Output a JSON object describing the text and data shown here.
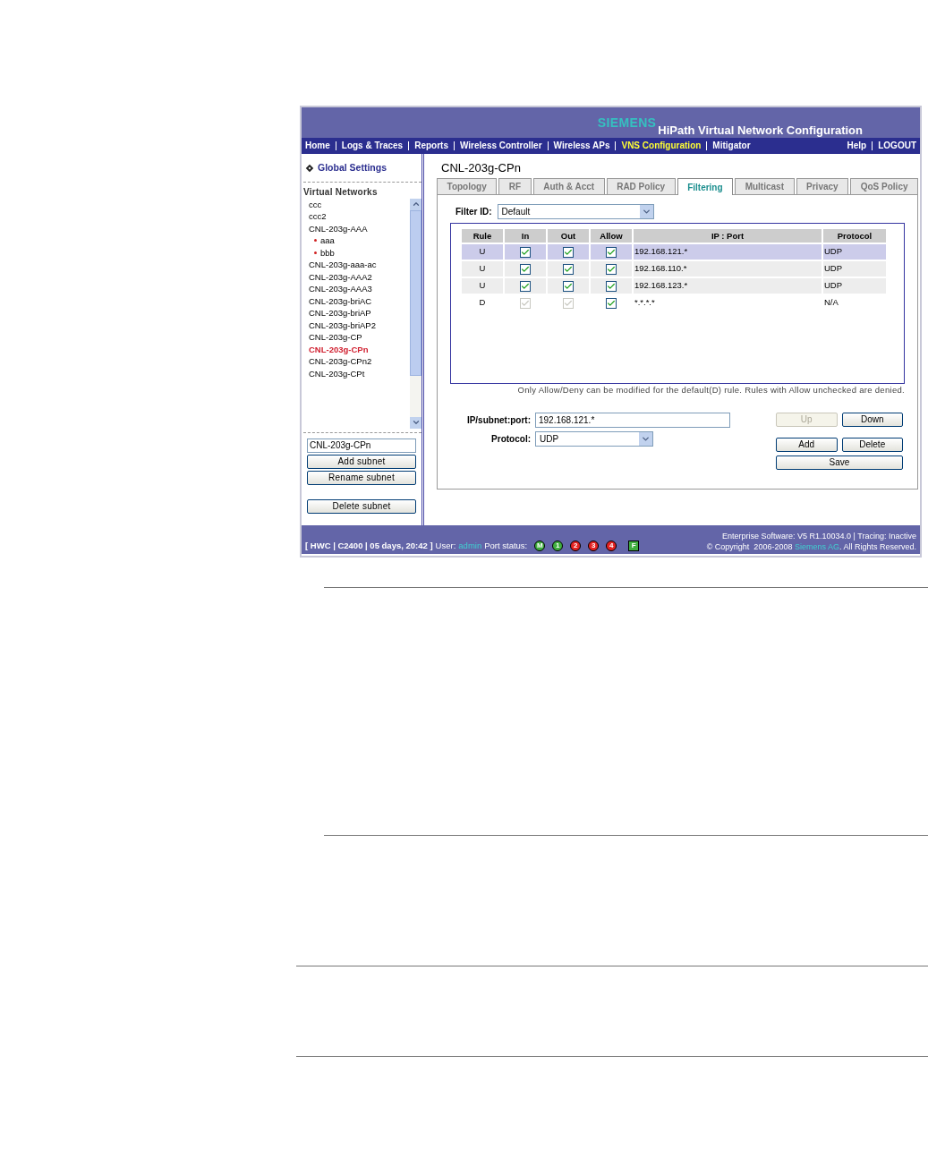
{
  "header": {
    "brand": "SIEMENS",
    "title": "HiPath Virtual Network Configuration"
  },
  "nav": {
    "items": [
      {
        "label": "Home",
        "selected": false
      },
      {
        "label": "Logs & Traces",
        "selected": false
      },
      {
        "label": "Reports",
        "selected": false
      },
      {
        "label": "Wireless Controller",
        "selected": false
      },
      {
        "label": "Wireless APs",
        "selected": false
      },
      {
        "label": "VNS Configuration",
        "selected": true
      },
      {
        "label": "Mitigator",
        "selected": false
      }
    ],
    "right_items": [
      {
        "label": "Help"
      },
      {
        "label": "LOGOUT"
      }
    ]
  },
  "sidebar": {
    "global_settings": "Global Settings",
    "section_title": "Virtual Networks",
    "items": [
      {
        "label": "ccc",
        "selected": false
      },
      {
        "label": "ccc2",
        "selected": false
      },
      {
        "label": "CNL-203g-AAA",
        "selected": false,
        "children": [
          {
            "label": "aaa",
            "selected": false
          },
          {
            "label": "bbb",
            "selected": false
          }
        ]
      },
      {
        "label": "CNL-203g-aaa-ac",
        "selected": false
      },
      {
        "label": "CNL-203g-AAA2",
        "selected": false
      },
      {
        "label": "CNL-203g-AAA3",
        "selected": false
      },
      {
        "label": "CNL-203g-briAC",
        "selected": false
      },
      {
        "label": "CNL-203g-briAP",
        "selected": false
      },
      {
        "label": "CNL-203g-briAP2",
        "selected": false
      },
      {
        "label": "CNL-203g-CP",
        "selected": false
      },
      {
        "label": "CNL-203g-CPn",
        "selected": true
      },
      {
        "label": "CNL-203g-CPn2",
        "selected": false
      },
      {
        "label": "CNL-203g-CPt",
        "selected": false
      }
    ],
    "name_field": {
      "value": "CNL-203g-CPn"
    },
    "buttons": [
      "Add subnet",
      "Rename subnet",
      "Delete subnet"
    ]
  },
  "main": {
    "title": "CNL-203g-CPn",
    "tabs": [
      {
        "label": "Topology",
        "selected": false
      },
      {
        "label": "RF",
        "selected": false
      },
      {
        "label": "Auth & Acct",
        "selected": false
      },
      {
        "label": "RAD Policy",
        "selected": false
      },
      {
        "label": "Filtering",
        "selected": true
      },
      {
        "label": "Multicast",
        "selected": false
      },
      {
        "label": "Privacy",
        "selected": false
      },
      {
        "label": "QoS Policy",
        "selected": false
      }
    ],
    "filter_id": {
      "label": "Filter ID:",
      "value": "Default"
    },
    "table": {
      "columns": [
        "Rule",
        "In",
        "Out",
        "Allow",
        "IP : Port",
        "Protocol"
      ],
      "rows": [
        {
          "rule": "U",
          "in": {
            "checked": true,
            "disabled": false
          },
          "out": {
            "checked": true,
            "disabled": false
          },
          "allow": {
            "checked": true,
            "disabled": false
          },
          "ip_port": "192.168.121.*",
          "protocol": "UDP",
          "selected": true
        },
        {
          "rule": "U",
          "in": {
            "checked": true,
            "disabled": false
          },
          "out": {
            "checked": true,
            "disabled": false
          },
          "allow": {
            "checked": true,
            "disabled": false
          },
          "ip_port": "192.168.110.*",
          "protocol": "UDP",
          "selected": false
        },
        {
          "rule": "U",
          "in": {
            "checked": true,
            "disabled": false
          },
          "out": {
            "checked": true,
            "disabled": false
          },
          "allow": {
            "checked": true,
            "disabled": false
          },
          "ip_port": "192.168.123.*",
          "protocol": "UDP",
          "selected": false
        },
        {
          "rule": "D",
          "in": {
            "checked": true,
            "disabled": true
          },
          "out": {
            "checked": true,
            "disabled": true
          },
          "allow": {
            "checked": true,
            "disabled": false
          },
          "ip_port": "*.*.*.*",
          "protocol": "N/A",
          "selected": false
        }
      ]
    },
    "note": "Only Allow/Deny can be modified for the default(D) rule. Rules with Allow unchecked are denied.",
    "ip_field": {
      "label": "IP/subnet:port:",
      "value": "192.168.121.*"
    },
    "protocol_field": {
      "label": "Protocol:",
      "value": "UDP"
    },
    "buttons": [
      {
        "label": "Up",
        "disabled": true
      },
      {
        "label": "Down",
        "disabled": false
      },
      {
        "label": "Add",
        "disabled": false
      },
      {
        "label": "Delete",
        "disabled": false
      },
      {
        "label": "Save",
        "disabled": false
      }
    ]
  },
  "footer": {
    "system": "[ HWC | C2400 | 05 days, 20:42 ]",
    "user_label": "User:",
    "user": "admin",
    "port_label": "Port status:",
    "ports": [
      {
        "label": "M",
        "color": "#3fae3f",
        "kind": "circle"
      },
      {
        "label": "1",
        "color": "#3fae3f",
        "kind": "circle"
      },
      {
        "label": "2",
        "color": "#e52222",
        "kind": "circle"
      },
      {
        "label": "3",
        "color": "#e52222",
        "kind": "circle"
      },
      {
        "label": "4",
        "color": "#e52222",
        "kind": "circle"
      },
      {
        "label": "F",
        "color": "#3fae3f",
        "kind": "square"
      }
    ],
    "software": "Enterprise Software: V5 R1.10034.0 | Tracing: Inactive",
    "copyright": "© Copyright  2006-2008",
    "company": "Siemens AG",
    "rights": ". All Rights Reserved."
  }
}
